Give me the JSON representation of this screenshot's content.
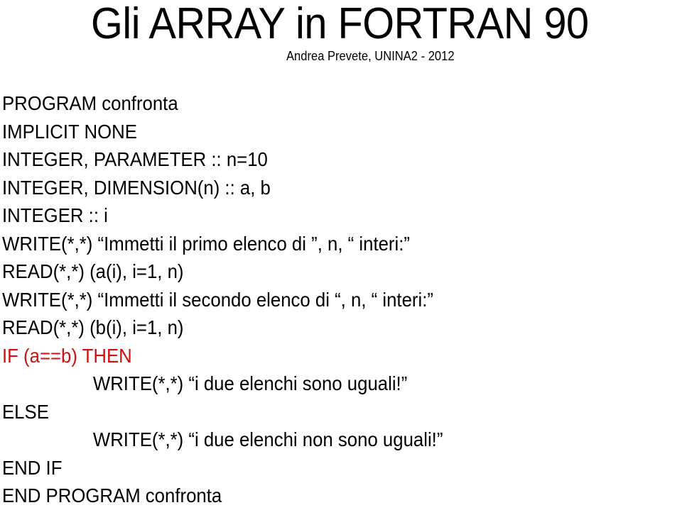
{
  "slide": {
    "title": "Gli ARRAY in FORTRAN 90",
    "subtitle": "Andrea Prevete, UNINA2 - 2012",
    "highlight_color": "#d01010",
    "code_lines": [
      {
        "text": "PROGRAM confronta",
        "indent": false,
        "highlight": false
      },
      {
        "text": "IMPLICIT NONE",
        "indent": false,
        "highlight": false
      },
      {
        "text": "INTEGER, PARAMETER :: n=10",
        "indent": false,
        "highlight": false
      },
      {
        "text": "INTEGER, DIMENSION(n) :: a, b",
        "indent": false,
        "highlight": false
      },
      {
        "text": "INTEGER :: i",
        "indent": false,
        "highlight": false
      },
      {
        "text": "WRITE(*,*) “Immetti il primo elenco di ”, n, “ interi:”",
        "indent": false,
        "highlight": false
      },
      {
        "text": "READ(*,*) (a(i), i=1, n)",
        "indent": false,
        "highlight": false
      },
      {
        "text": "WRITE(*,*) “Immetti il secondo elenco di “, n, “ interi:”",
        "indent": false,
        "highlight": false
      },
      {
        "text": "READ(*,*) (b(i), i=1, n)",
        "indent": false,
        "highlight": false
      },
      {
        "text": "IF (a==b) THEN",
        "indent": false,
        "highlight": true
      },
      {
        "text": "WRITE(*,*) “i due elenchi sono uguali!”",
        "indent": true,
        "highlight": false
      },
      {
        "text": "ELSE",
        "indent": false,
        "highlight": false
      },
      {
        "text": "WRITE(*,*) “i due elenchi non sono uguali!”",
        "indent": true,
        "highlight": false
      },
      {
        "text": "END IF",
        "indent": false,
        "highlight": false
      },
      {
        "text": "END PROGRAM confronta",
        "indent": false,
        "highlight": false
      }
    ]
  }
}
